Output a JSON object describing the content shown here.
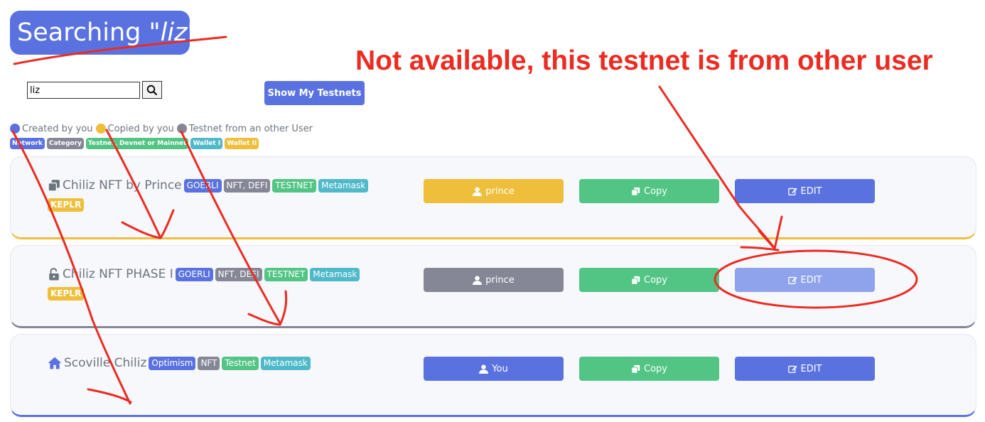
{
  "header": {
    "title_prefix": "Searching \"",
    "query": "liz",
    "title_suffix": "\""
  },
  "search": {
    "value": "liz"
  },
  "show_button": "Show My Testnets",
  "legend": {
    "created": "Created by you",
    "copied": "Copied by you",
    "other": "Testnet from an other User"
  },
  "legend_badges": [
    "Network",
    "Category",
    "Testnet, Devnet or Mainnet",
    "Wallet I",
    "Wallet II"
  ],
  "cards": [
    {
      "title": "Chiliz NFT by Prince",
      "network": "GOERLI",
      "category": "NFT, DEFI",
      "type": "TESTNET",
      "wallet1": "Metamask",
      "wallet2": "KEPLR",
      "owner": "prince",
      "copy": "Copy",
      "edit": "EDIT"
    },
    {
      "title": "Chiliz NFT PHASE I",
      "network": "GOERLI",
      "category": "NFT, DEFI",
      "type": "TESTNET",
      "wallet1": "Metamask",
      "wallet2": "KEPLR",
      "owner": "prince",
      "copy": "Copy",
      "edit": "EDIT"
    },
    {
      "title": "Scoville Chiliz",
      "network": "Optimism",
      "category": "NFT",
      "type": "Testnet",
      "wallet1": "Metamask",
      "owner": "You",
      "copy": "Copy",
      "edit": "EDIT"
    }
  ],
  "annotation": "Not available, this testnet is from other user",
  "colors": {
    "primary": "#5a72e0",
    "secondary": "#858796",
    "success": "#52c585",
    "info": "#4fb9c9",
    "warning": "#efbe3a",
    "annotation_red": "#ea2c22",
    "edit_disabled": "#8fa3ec"
  },
  "icons": [
    "search-icon",
    "copy-icon",
    "lock-open-icon",
    "home-icon",
    "user-icon",
    "edit-icon"
  ]
}
